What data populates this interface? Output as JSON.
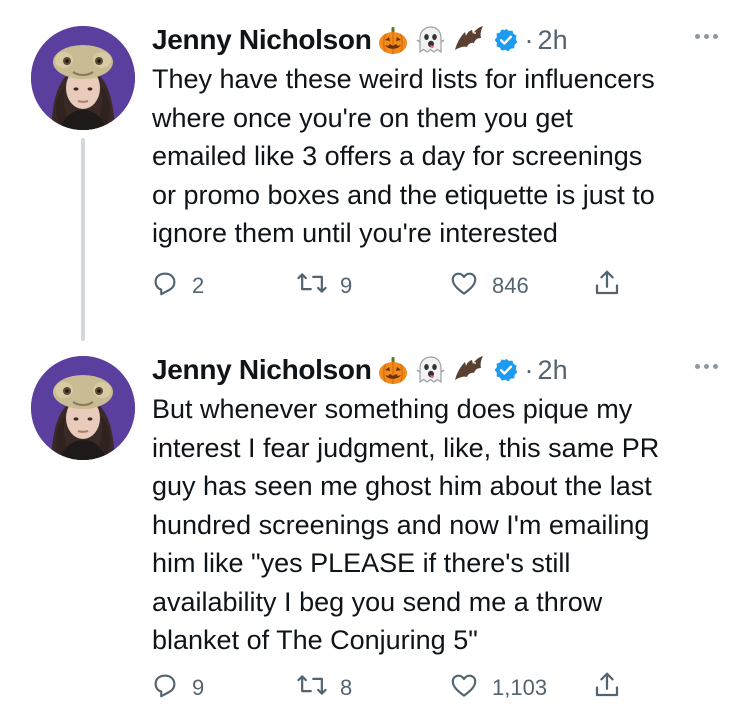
{
  "tweets": [
    {
      "author": "Jenny Nicholson",
      "timestamp": "2h",
      "text": "They have these weird lists for influencers\nwhere once you're on them you get\nemailed like 3 offers a day for screenings\nor promo boxes and the etiquette is just to\nignore them until you're interested",
      "stats": {
        "replies": "2",
        "retweets": "9",
        "likes": "846"
      }
    },
    {
      "author": "Jenny Nicholson",
      "timestamp": "2h",
      "text": "But whenever something does pique my\ninterest I fear judgment, like, this same PR\nguy has seen me ghost him about the last\nhundred screenings and now I'm emailing\nhim like \"yes PLEASE if there's still\navailability I beg you send me a throw\nblanket of The Conjuring 5\"",
      "stats": {
        "replies": "9",
        "retweets": "8",
        "likes": "1,103"
      }
    }
  ],
  "name_emojis": [
    "jack-o-lantern-icon",
    "ghost-icon",
    "bat-icon"
  ],
  "colors": {
    "text": "#0f1419",
    "secondary": "#536471",
    "verified": "#1d9bf0",
    "thread_line": "#cfd9de",
    "avatar_bg": "#5b3f9e"
  }
}
